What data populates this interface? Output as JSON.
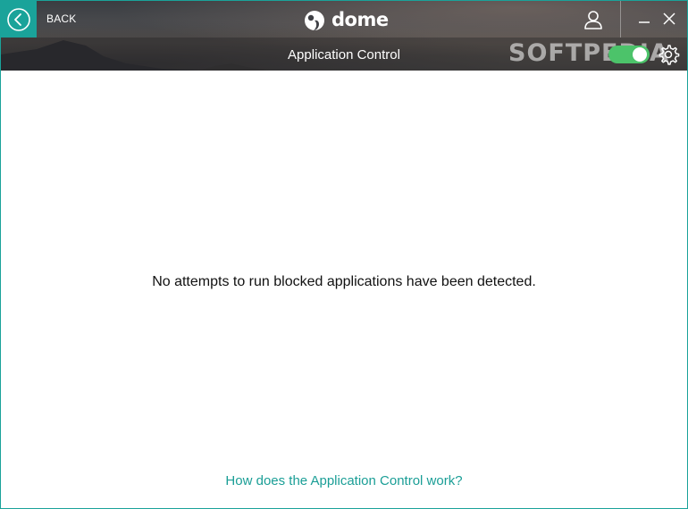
{
  "header": {
    "back_label": "BACK",
    "logo_text": "dome",
    "section_title": "Application Control",
    "watermark": "SOFTPEDIA",
    "toggle_on": true,
    "icons": {
      "back": "chevron-left-circle-icon",
      "logo": "panda-logo-icon",
      "user": "user-icon",
      "minimize": "minimize-icon",
      "close": "close-icon",
      "settings": "gear-icon"
    }
  },
  "main": {
    "empty_message": "No attempts to run blocked applications have been detected.",
    "help_link": "How does the Application Control work?"
  },
  "colors": {
    "accent": "#1aa39a",
    "toggle_on": "#4cc36a",
    "link": "#1a9e96"
  }
}
